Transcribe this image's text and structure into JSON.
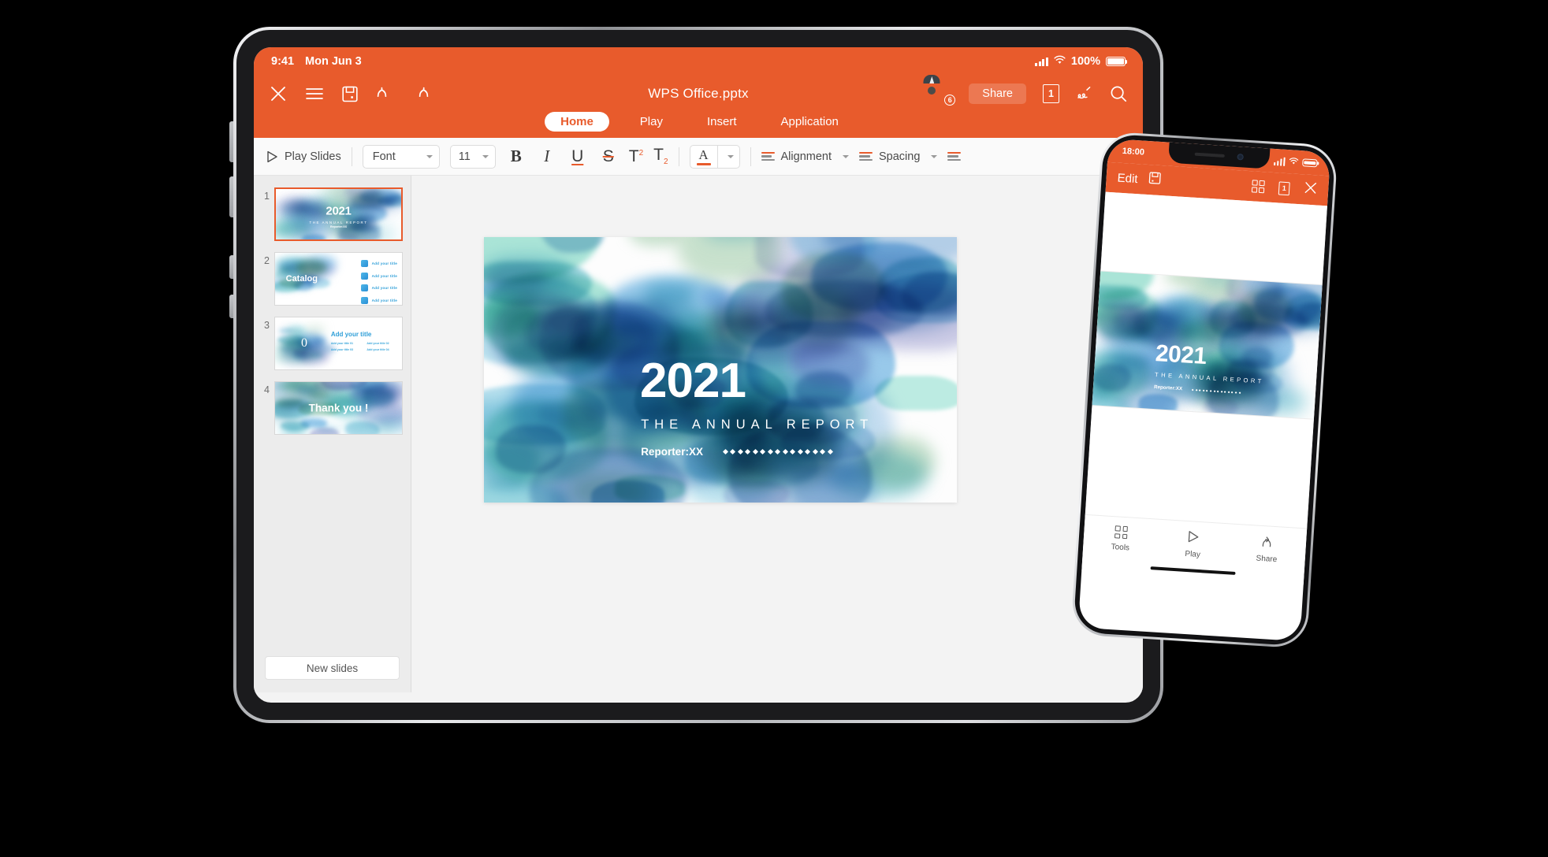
{
  "tablet": {
    "status_bar": {
      "time": "9:41",
      "date": "Mon Jun 3",
      "battery_percent": "100%",
      "wifi_icon": "wifi-icon",
      "signal_icon": "cellular-signal-icon",
      "battery_icon": "battery-icon"
    },
    "header": {
      "document_title": "WPS Office.pptx",
      "close_icon": "close-icon",
      "menu_icon": "hamburger-menu-icon",
      "save_icon": "save-icon",
      "undo_icon": "undo-icon",
      "redo_icon": "redo-icon",
      "avatar_icon": "avatar-icon",
      "collaborator_count": "6",
      "share_label": "Share",
      "page_count": "1",
      "pen_icon": "pen-icon",
      "search_icon": "search-icon",
      "tabs": [
        {
          "label": "Home",
          "active": true
        },
        {
          "label": "Play",
          "active": false
        },
        {
          "label": "Insert",
          "active": false
        },
        {
          "label": "Application",
          "active": false
        }
      ]
    },
    "ribbon": {
      "play_slides_label": "Play Slides",
      "play_icon": "play-triangle-icon",
      "font_value": "Font",
      "font_size_value": "11",
      "bold_label": "B",
      "italic_label": "I",
      "underline_label": "U",
      "strikethrough_label": "S",
      "superscript_label": "T",
      "superscript_mark": "2",
      "subscript_label": "T",
      "subscript_mark": "2",
      "font_color_label": "A",
      "alignment_label": "Alignment",
      "spacing_label": "Spacing"
    },
    "slide_panel": {
      "new_slides_label": "New slides",
      "slides": [
        {
          "number": "1",
          "layout": "title",
          "title": "2021",
          "subtitle": "THE ANNUAL REPORT",
          "reporter": "Reporter:XX",
          "selected": true
        },
        {
          "number": "2",
          "layout": "catalog",
          "title": "Catalog",
          "items": [
            "Add your title",
            "Add your title",
            "Add your title",
            "Add your title"
          ],
          "selected": false
        },
        {
          "number": "3",
          "layout": "section",
          "number_label": "0",
          "title": "Add your title",
          "bullets": [
            "Add your title 01",
            "Add your title 02",
            "Add your title 03",
            "Add your title 04"
          ],
          "selected": false
        },
        {
          "number": "4",
          "layout": "thanks",
          "title": "Thank you !",
          "selected": false
        }
      ]
    },
    "canvas": {
      "slide": {
        "title": "2021",
        "subtitle": "THE ANNUAL REPORT",
        "reporter": "Reporter:XX",
        "dots_count": 15
      }
    }
  },
  "phone": {
    "status_bar": {
      "time": "18:00",
      "signal_icon": "cellular-signal-icon",
      "wifi_icon": "wifi-icon",
      "battery_icon": "battery-icon"
    },
    "toolbar": {
      "edit_label": "Edit",
      "save_icon": "save-icon",
      "grid_icon": "grid-view-icon",
      "page_count": "1",
      "close_icon": "close-icon"
    },
    "slide": {
      "title": "2021",
      "subtitle": "THE ANNUAL REPORT",
      "reporter": "Reporter:XX",
      "dots_count": 14
    },
    "bottom_bar": [
      {
        "label": "Tools",
        "icon": "tools-grid-icon"
      },
      {
        "label": "Play",
        "icon": "play-triangle-icon"
      },
      {
        "label": "Share",
        "icon": "share-arrow-icon"
      }
    ]
  },
  "colors": {
    "accent_orange": "#e85b2c",
    "page_background": "#000000",
    "canvas_background": "#f3f3f3",
    "panel_background": "#ececec"
  }
}
